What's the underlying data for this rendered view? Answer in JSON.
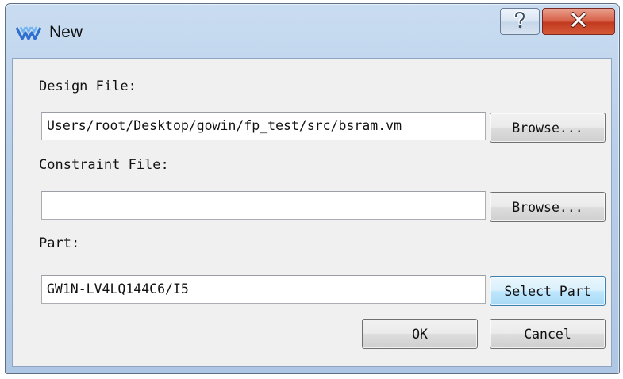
{
  "window": {
    "title": "New",
    "help_glyph": "?",
    "close_glyph": "X",
    "icon": "gowin-logo-icon"
  },
  "form": {
    "design_file": {
      "label": "Design File:",
      "value": "Users/root/Desktop/gowin/fp_test/src/bsram.vm",
      "browse_label": "Browse..."
    },
    "constraint_file": {
      "label": "Constraint File:",
      "value": "",
      "browse_label": "Browse..."
    },
    "part": {
      "label": "Part:",
      "value": "GW1N-LV4LQ144C6/I5",
      "select_label": "Select Part"
    }
  },
  "actions": {
    "ok_label": "OK",
    "cancel_label": "Cancel"
  },
  "colors": {
    "logo": "#2f6fd0",
    "close_button": "#c9452c",
    "frame": "#b8cfe9",
    "dialog_bg": "#f0f0f0"
  }
}
